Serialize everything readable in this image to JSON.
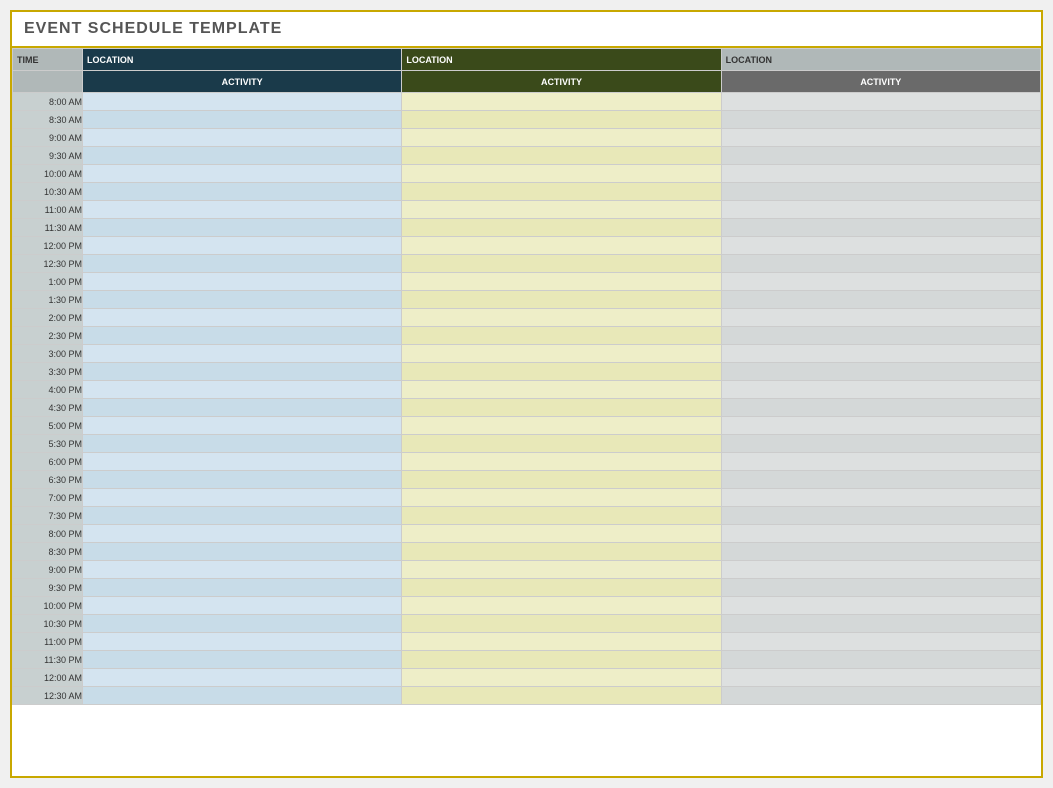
{
  "title": "EVENT SCHEDULE TEMPLATE",
  "columns": {
    "location_label": "LOCATION",
    "time_label": "TIME",
    "activity_label": "ACTIVITY"
  },
  "timeSlots": [
    "8:00 AM",
    "8:30 AM",
    "9:00 AM",
    "9:30 AM",
    "10:00 AM",
    "10:30 AM",
    "11:00 AM",
    "11:30 AM",
    "12:00 PM",
    "12:30 PM",
    "1:00 PM",
    "1:30 PM",
    "2:00 PM",
    "2:30 PM",
    "3:00 PM",
    "3:30 PM",
    "4:00 PM",
    "4:30 PM",
    "5:00 PM",
    "5:30 PM",
    "6:00 PM",
    "6:30 PM",
    "7:00 PM",
    "7:30 PM",
    "8:00 PM",
    "8:30 PM",
    "9:00 PM",
    "9:30 PM",
    "10:00 PM",
    "10:30 PM",
    "11:00 PM",
    "11:30 PM",
    "12:00 AM",
    "12:30 AM"
  ]
}
